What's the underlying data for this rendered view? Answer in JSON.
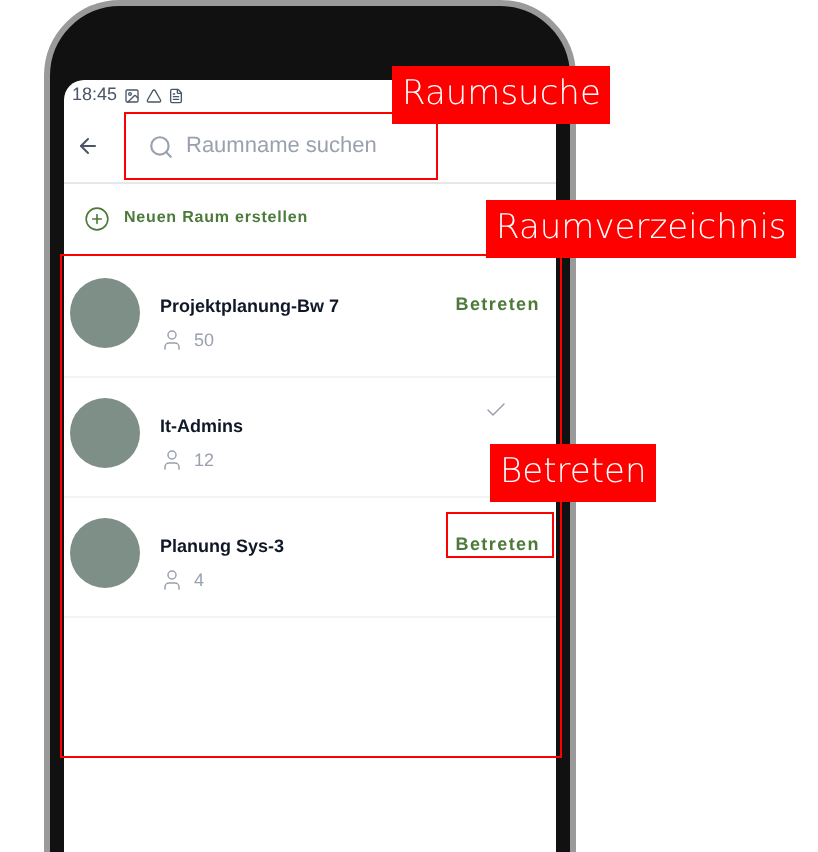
{
  "status_bar": {
    "time": "18:45"
  },
  "search": {
    "placeholder": "Raumname suchen"
  },
  "create": {
    "label": "Neuen Raum erstellen"
  },
  "rooms": [
    {
      "name": "Projektplanung-Bw 7",
      "members": "50",
      "action": {
        "kind": "join",
        "label": "Betreten"
      }
    },
    {
      "name": "It-Admins",
      "members": "12",
      "action": {
        "kind": "joined"
      }
    },
    {
      "name": "Planung Sys-3",
      "members": "4",
      "action": {
        "kind": "join",
        "label": "Betreten"
      }
    }
  ],
  "annotations": [
    {
      "label": "Raumsuche"
    },
    {
      "label": "Raumverzeichnis"
    },
    {
      "label": "Betreten"
    }
  ]
}
